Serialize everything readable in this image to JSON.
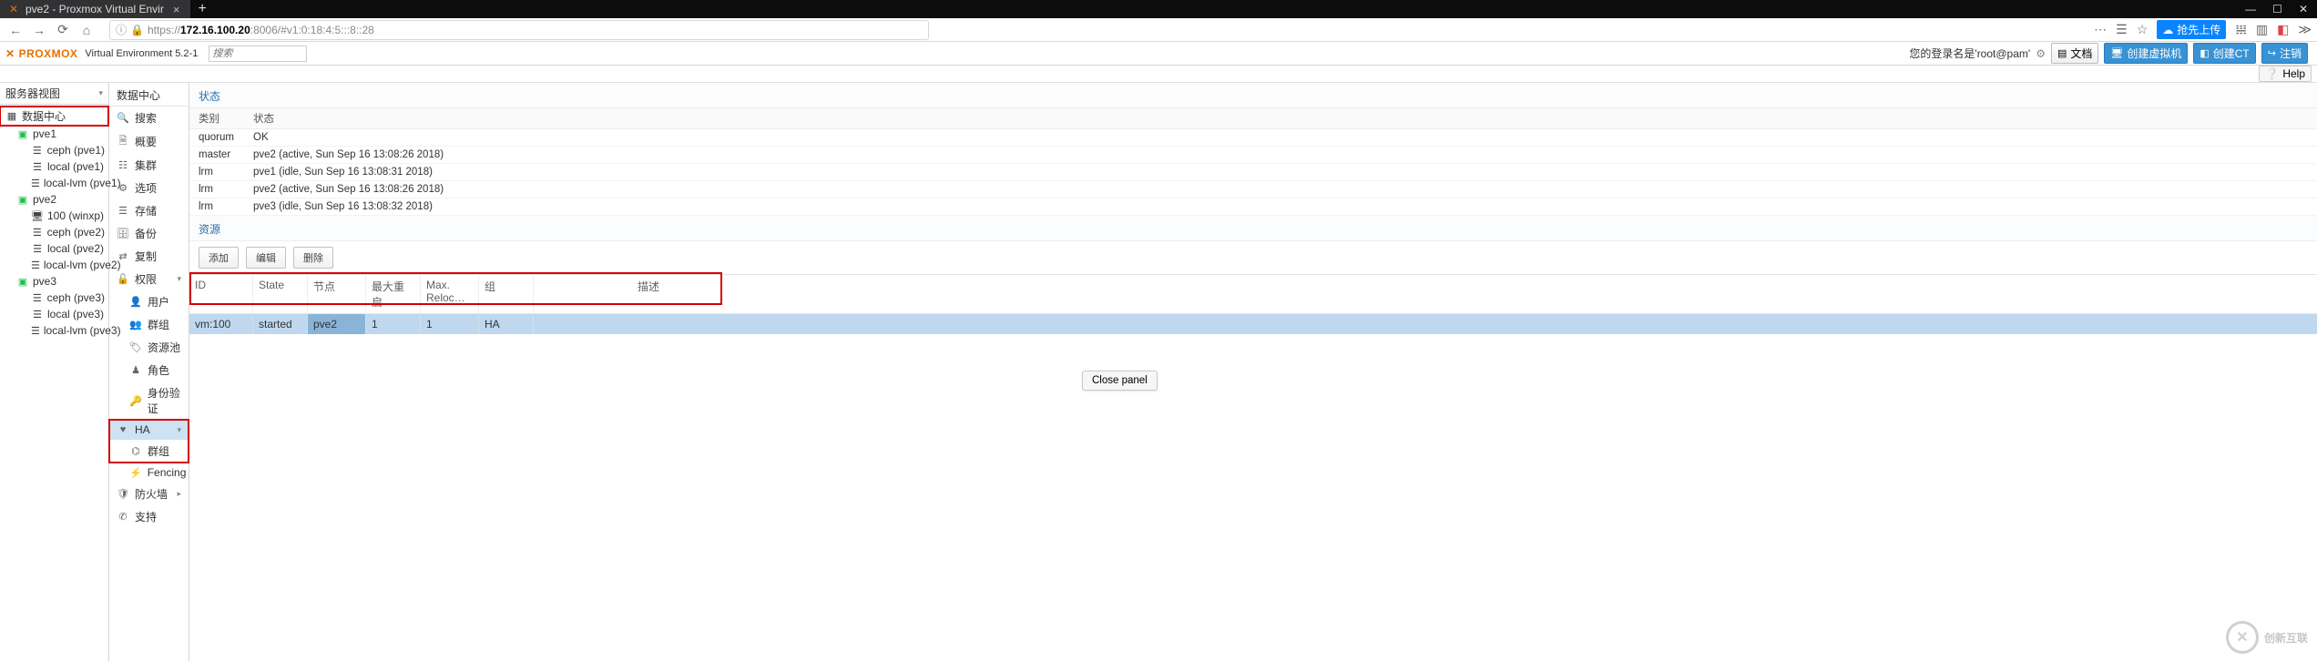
{
  "browser": {
    "tab_title": "pve2 - Proxmox Virtual Envir",
    "url_proto": "https://",
    "url_host": "172.16.100.20",
    "url_rest": ":8006/#v1:0:18:4:5:::8::28",
    "upload_label": "抢先上传"
  },
  "header": {
    "logo_text": "PROXMOX",
    "version": "Virtual Environment 5.2-1",
    "search_placeholder": "搜索",
    "login_prefix": "您的登录名是'",
    "login_user": "root@pam",
    "login_suffix": "'",
    "btn_docs": "文档",
    "btn_createvm": "创建虚拟机",
    "btn_createct": "创建CT",
    "btn_logout": "注销",
    "help": "Help"
  },
  "sidebar": {
    "view_label": "服务器视图",
    "tree": {
      "root": "数据中心",
      "pve1": {
        "name": "pve1",
        "ceph": "ceph (pve1)",
        "local": "local (pve1)",
        "locallvm": "local-lvm (pve1)"
      },
      "pve2": {
        "name": "pve2",
        "vm": "100 (winxp)",
        "ceph": "ceph (pve2)",
        "local": "local (pve2)",
        "locallvm": "local-lvm (pve2)"
      },
      "pve3": {
        "name": "pve3",
        "ceph": "ceph (pve3)",
        "local": "local (pve3)",
        "locallvm": "local-lvm (pve3)"
      }
    }
  },
  "menu": {
    "title": "数据中心",
    "search": "搜索",
    "summary": "概要",
    "cluster": "集群",
    "options": "选项",
    "storage": "存储",
    "backup": "备份",
    "replication": "复制",
    "permissions": "权限",
    "users": "用户",
    "groups": "群组",
    "pools": "资源池",
    "roles": "角色",
    "auth": "身份验证",
    "ha": "HA",
    "ha_groups": "群组",
    "fencing": "Fencing",
    "firewall": "防火墙",
    "support": "支持"
  },
  "panel": {
    "status_title": "状态",
    "th_kind": "类别",
    "th_status": "状态",
    "rows": [
      {
        "k": "quorum",
        "v": "OK"
      },
      {
        "k": "master",
        "v": "pve2 (active, Sun Sep 16 13:08:26 2018)"
      },
      {
        "k": "lrm",
        "v": "pve1 (idle, Sun Sep 16 13:08:31 2018)"
      },
      {
        "k": "lrm",
        "v": "pve2 (active, Sun Sep 16 13:08:26 2018)"
      },
      {
        "k": "lrm",
        "v": "pve3 (idle, Sun Sep 16 13:08:32 2018)"
      }
    ],
    "resources_title": "资源",
    "btn_add": "添加",
    "btn_edit": "编辑",
    "btn_remove": "删除",
    "col_id": "ID",
    "col_state": "State",
    "col_node": "节点",
    "col_maxrestart": "最大重启",
    "col_maxreloc": "Max. Reloc…",
    "col_group": "组",
    "col_desc": "描述",
    "row": {
      "id": "vm:100",
      "state": "started",
      "node": "pve2",
      "maxrestart": "1",
      "maxreloc": "1",
      "group": "HA",
      "desc": ""
    },
    "close_panel": "Close panel"
  },
  "watermark": "创新互联"
}
